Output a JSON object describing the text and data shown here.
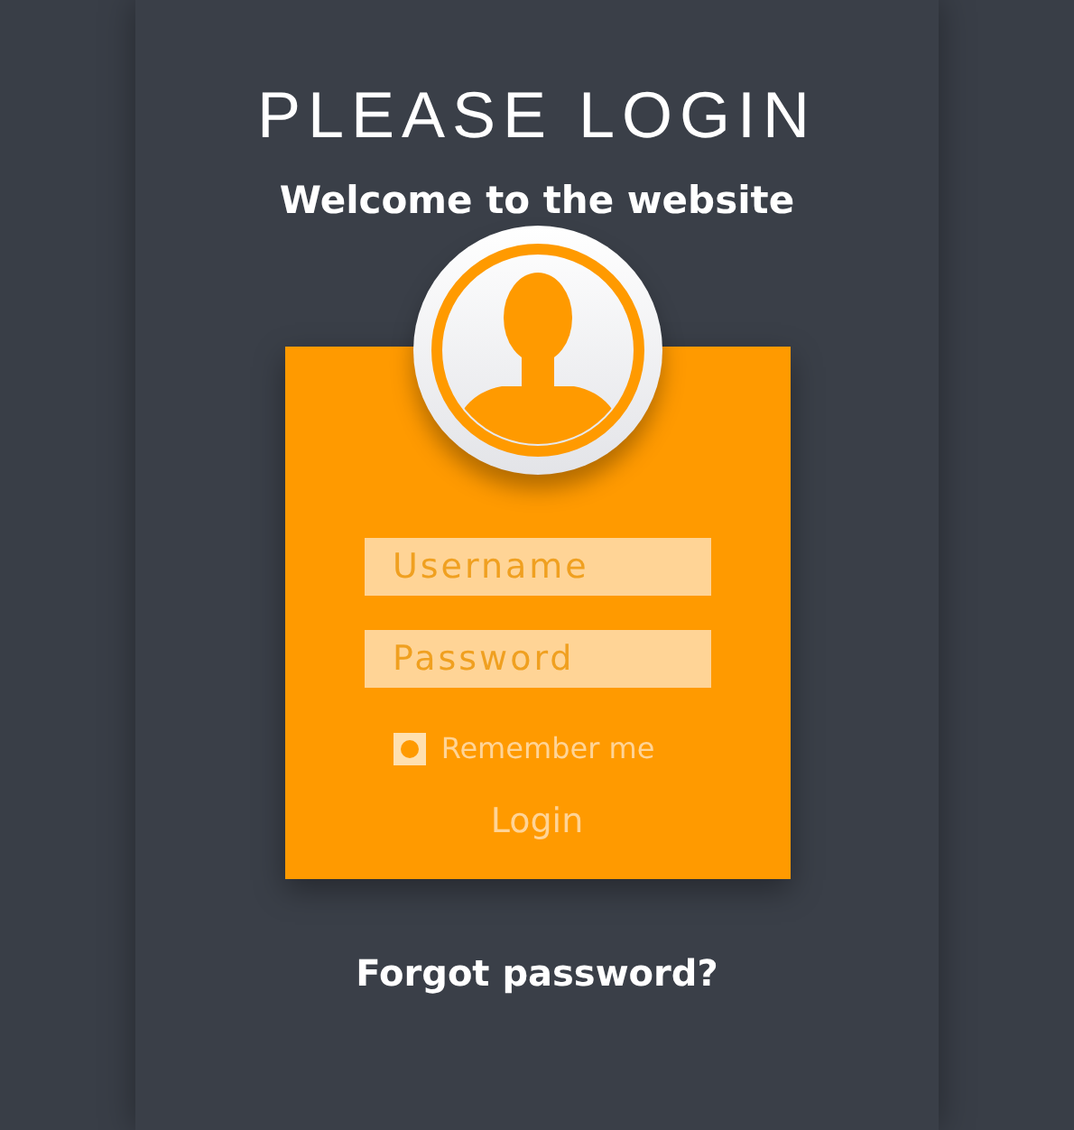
{
  "title": "PLEASE LOGIN",
  "subtitle": "Welcome to the website",
  "form": {
    "username": {
      "placeholder": "Username"
    },
    "password": {
      "placeholder": "Password"
    },
    "remember": {
      "label": "Remember me",
      "checked": true
    },
    "login_button": "Login"
  },
  "forgot_link": "Forgot password?"
}
